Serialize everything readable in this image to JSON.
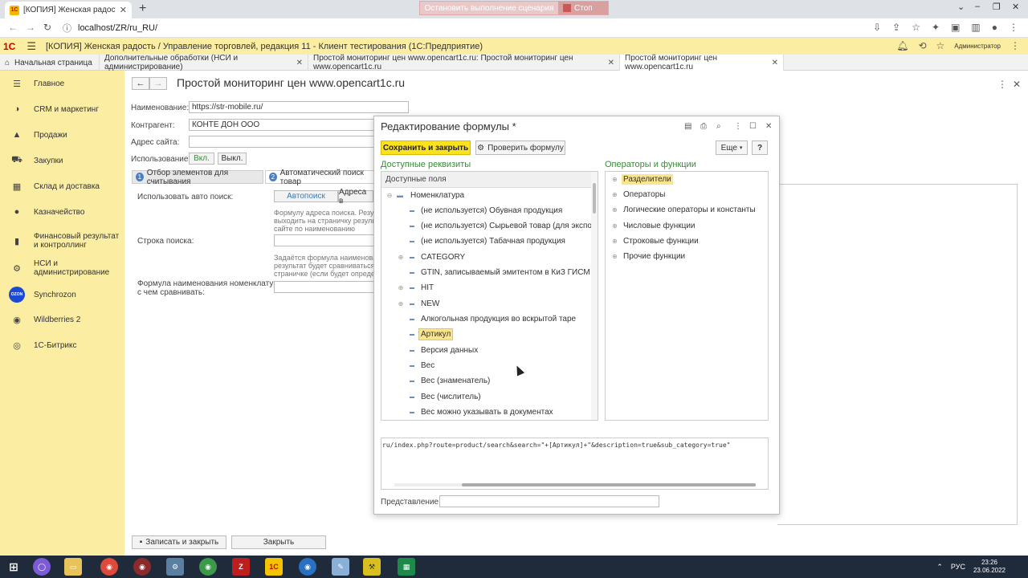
{
  "browser": {
    "tab_title": "[КОПИЯ] Женская радость / Упр",
    "url": "localhost/ZR/ru_RU/",
    "script_stop_label": "Остановить выполнение сценария",
    "script_stop_button": "Стоп"
  },
  "app": {
    "logo": "1С",
    "title": "[КОПИЯ] Женская радость / Управление торговлей, редакция 11 - Клиент тестирования (1С:Предприятие)",
    "user": "Администратор"
  },
  "open_tabs": [
    {
      "label": "Начальная страница"
    },
    {
      "label": "Дополнительные обработки (НСИ и администрирование)"
    },
    {
      "label": "Простой мониторинг цен www.opencart1c.ru: Простой мониторинг цен www.opencart1c.ru"
    },
    {
      "label": "Простой мониторинг цен www.opencart1c.ru"
    }
  ],
  "sidebar": {
    "items": [
      {
        "label": "Главное",
        "icon": "menu-icon"
      },
      {
        "label": "CRM и маркетинг",
        "icon": "crm-icon"
      },
      {
        "label": "Продажи",
        "icon": "bag-icon"
      },
      {
        "label": "Закупки",
        "icon": "cart-icon"
      },
      {
        "label": "Склад и доставка",
        "icon": "warehouse-icon"
      },
      {
        "label": "Казначейство",
        "icon": "money-icon"
      },
      {
        "label": "Финансовый результат и контроллинг",
        "icon": "chart-icon"
      },
      {
        "label": "НСИ и администрирование",
        "icon": "gear-icon"
      },
      {
        "label": "Synchrozon",
        "icon": "ozon-icon"
      },
      {
        "label": "Wildberries 2",
        "icon": "wb-icon"
      },
      {
        "label": "1С-Битрикс",
        "icon": "bitrix-icon"
      }
    ]
  },
  "document": {
    "title": "Простой мониторинг цен www.opencart1c.ru",
    "name_label": "Наименование:",
    "name_value": "https://str-mobile.ru/",
    "counterparty_label": "Контрагент:",
    "counterparty_value": "КОНТЕ ДОН ООО",
    "site_label": "Адрес сайта:",
    "usage_label": "Использование:",
    "on_label": "Вкл.",
    "off_label": "Выкл.",
    "subtab1": "Отбор элементов для считывания",
    "subtab1_num": "1",
    "subtab2": "Автоматический поиск товар",
    "subtab2_num": "2",
    "auto_search_label": "Использовать авто поиск:",
    "autosearch_btn": "Автопоиск",
    "address_btn": "Адреса в",
    "hint1_l1": "Формулу адреса поиска. Резул",
    "hint1_l2": "выходить на страничку резуль",
    "hint1_l3": "сайте по наименованию",
    "search_string_label": "Строка поиска:",
    "hint2_l1": "Задаётся формула наименова",
    "hint2_l2": "результат будет сравниваться",
    "hint2_l3": "страничке (если будет опреде",
    "formula_label_l1": "Формула наименования номенклатуры,",
    "formula_label_l2": "с чем сравнивать:",
    "save_close": "Записать и закрыть",
    "close": "Закрыть"
  },
  "modal": {
    "title": "Редактирование формулы *",
    "save_close": "Сохранить и закрыть",
    "check": "Проверить формулу",
    "more": "Еще",
    "help": "?",
    "fields_title": "Доступные реквизиты",
    "fields_header": "Доступные поля",
    "ops_title": "Операторы и функции",
    "tree": [
      {
        "label": "Номенклатура"
      },
      {
        "label": "(не используется) Обувная продукция"
      },
      {
        "label": "(не используется) Сырьевой товар (для экспорта)"
      },
      {
        "label": "(не используется) Табачная продукция"
      },
      {
        "label": "CATEGORY"
      },
      {
        "label": "GTIN, записываемый эмитентом в КиЗ ГИСМ"
      },
      {
        "label": "HIT"
      },
      {
        "label": "NEW"
      },
      {
        "label": "Алкогольная продукция во вскрытой таре"
      },
      {
        "label": "Артикул"
      },
      {
        "label": "Версия данных"
      },
      {
        "label": "Вес"
      },
      {
        "label": "Вес (знаменатель)"
      },
      {
        "label": "Вес (числитель)"
      },
      {
        "label": "Вес можно указывать в документах"
      }
    ],
    "ops": [
      {
        "label": "Разделители"
      },
      {
        "label": "Операторы"
      },
      {
        "label": "Логические операторы и константы"
      },
      {
        "label": "Числовые функции"
      },
      {
        "label": "Строковые функции"
      },
      {
        "label": "Прочие функции"
      }
    ],
    "formula_text": "ru/index.php?route=product/search&search=\"+[Артикул]+\"&description=true&sub_category=true\"",
    "repr_label": "Представление:"
  },
  "taskbar": {
    "lang": "РУС",
    "time": "23:26",
    "date": "23.06.2022"
  }
}
